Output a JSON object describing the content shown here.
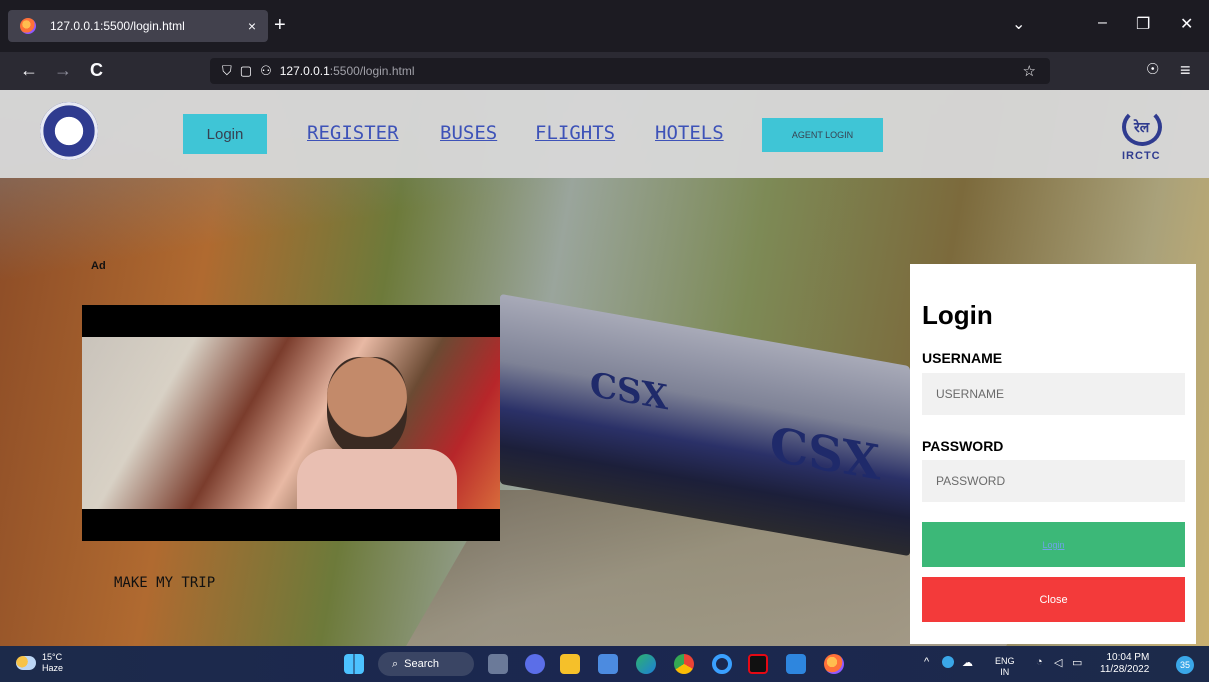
{
  "browser": {
    "tab_title": "127.0.0.1:5500/login.html",
    "tab_close": "×",
    "new_tab": "+",
    "tab_list": "⌄",
    "minimize": "–",
    "restore": "❐",
    "close": "✕",
    "back": "←",
    "forward": "→",
    "reload": "C",
    "url_host": "127.0.0.1",
    "url_path": ":5500/login.html",
    "bookmark": "☆",
    "pocket": "☉",
    "menu": "≡"
  },
  "header": {
    "login_label": "Login",
    "links": [
      "REGISTER",
      "BUSES",
      "FLIGHTS",
      "HOTELS"
    ],
    "agent_login_label": "AGENT LOGIN",
    "irctc_mark": "रेल",
    "irctc_label": "IRCTC"
  },
  "hero": {
    "train_text_1": "CSX",
    "train_text_2": "CSX"
  },
  "ad": {
    "label": "Ad",
    "caption": "MAKE MY TRIP"
  },
  "login_form": {
    "title": "Login",
    "username_label": "USERNAME",
    "username_placeholder": "USERNAME",
    "password_label": "PASSWORD",
    "password_placeholder": "PASSWORD",
    "login_button": "Login",
    "close_button": "Close"
  },
  "taskbar": {
    "temperature": "15°C",
    "weather": "Haze",
    "search_label": "Search",
    "language_1": "ENG",
    "language_2": "IN",
    "time": "10:04 PM",
    "date": "11/28/2022",
    "notification_count": "35",
    "tray_chevron": "^"
  },
  "colors": {
    "nav_button": "#3fc5d6",
    "nav_link": "#3d52b8",
    "login_button": "#3cb878",
    "close_button": "#f33a3a"
  }
}
